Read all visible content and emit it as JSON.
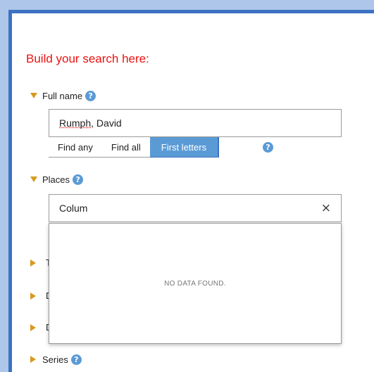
{
  "form": {
    "heading": "Build your search here:",
    "help_glyph": "?",
    "sections": {
      "full_name": {
        "label": "Full name"
      },
      "places": {
        "label": "Places"
      },
      "collapsed_initials": [
        "T",
        "D",
        "D"
      ],
      "series": {
        "label": "Series"
      }
    },
    "full_name_input": {
      "value_underlined": "Rumph",
      "value_rest": ", David"
    },
    "match_modes": [
      {
        "label": "Find any",
        "active": false
      },
      {
        "label": "Find all",
        "active": false
      },
      {
        "label": "First letters",
        "active": true
      }
    ],
    "places_input": {
      "value": "Colum",
      "clear_glyph": "×"
    },
    "dropdown": {
      "message": "NO DATA FOUND."
    }
  },
  "colors": {
    "heading": "#ee1111",
    "accent": "#5b9bd5",
    "border_blue": "#3d72c4",
    "triangle": "#d79a1f"
  }
}
